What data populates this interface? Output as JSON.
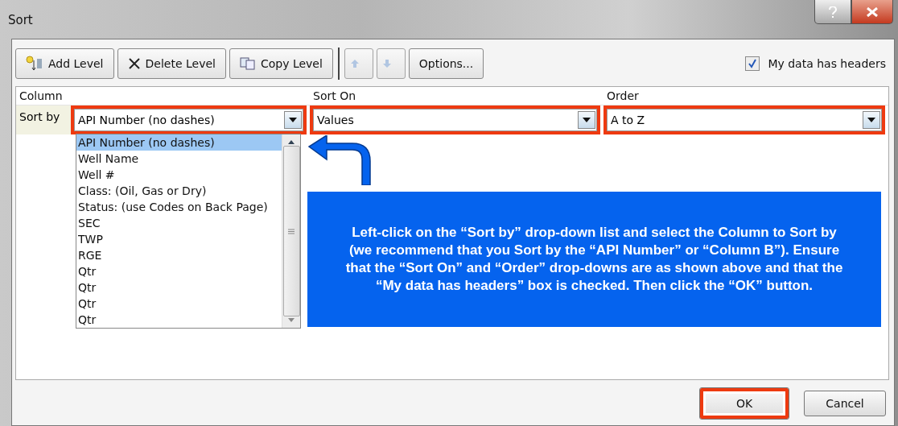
{
  "window": {
    "title": "Sort"
  },
  "toolbar": {
    "buttons": [
      {
        "kind": "add",
        "label": "Add Level"
      },
      {
        "kind": "delete",
        "label": "Delete Level"
      },
      {
        "kind": "copy",
        "label": "Copy Level"
      },
      {
        "kind": "up",
        "disabled": true
      },
      {
        "kind": "down",
        "disabled": true
      },
      {
        "kind": "text",
        "label": "Options..."
      }
    ],
    "headers_checkbox": {
      "label": "My data has headers",
      "checked": true
    }
  },
  "columns": [
    "Column",
    "Sort On",
    "Order"
  ],
  "row": {
    "label": "Sort by",
    "fields": [
      {
        "value": "API Number (no dashes)",
        "highlighted": true
      },
      {
        "value": "Values",
        "highlighted": true
      },
      {
        "value": "A to Z",
        "highlighted": true
      }
    ]
  },
  "dropdown": {
    "items": [
      {
        "label": "API Number (no dashes)",
        "selected": true
      },
      {
        "label": "Well Name",
        "selected": false
      },
      {
        "label": "Well #",
        "selected": false
      },
      {
        "label": "Class: (Oil, Gas or Dry)",
        "selected": false
      },
      {
        "label": "Status: (use Codes on Back Page)",
        "selected": false
      },
      {
        "label": "SEC",
        "selected": false
      },
      {
        "label": "TWP",
        "selected": false
      },
      {
        "label": "RGE",
        "selected": false
      },
      {
        "label": "Qtr",
        "selected": false
      },
      {
        "label": "Qtr",
        "selected": false
      },
      {
        "label": "Qtr",
        "selected": false
      },
      {
        "label": "Qtr",
        "selected": false
      }
    ]
  },
  "callout": {
    "text": "Left-click on the “Sort by” drop-down list and select the Column to Sort by (we recommend that you Sort by the “API Number” or “Column B”). Ensure that the “Sort On” and “Order” drop-downs are as shown above and that the “My data has headers” box is checked. Then click the “OK” button."
  },
  "buttons": [
    {
      "label": "OK",
      "highlighted": true
    },
    {
      "label": "Cancel",
      "highlighted": false
    }
  ]
}
